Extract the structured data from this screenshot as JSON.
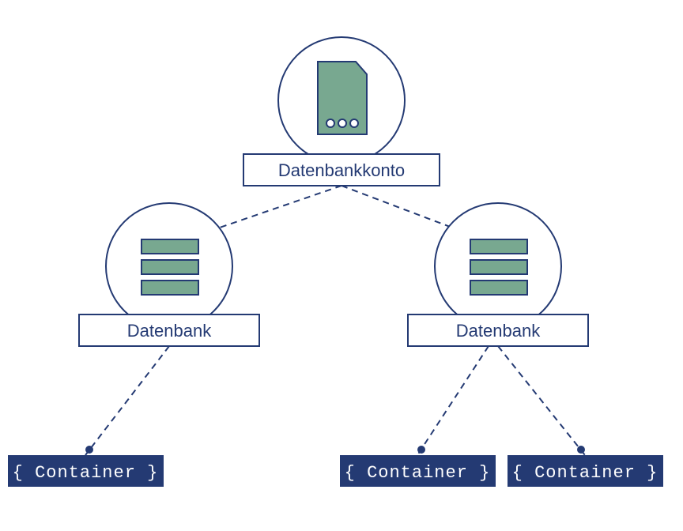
{
  "diagram": {
    "root": {
      "label": "Datenbankkonto"
    },
    "databases": [
      {
        "label": "Datenbank"
      },
      {
        "label": "Datenbank"
      }
    ],
    "containers": [
      {
        "label": "{ Container }"
      },
      {
        "label": "{ Container }"
      },
      {
        "label": "{ Container }"
      }
    ]
  },
  "colors": {
    "primary": "#243a73",
    "accent": "#78a890",
    "bg": "#ffffff"
  }
}
